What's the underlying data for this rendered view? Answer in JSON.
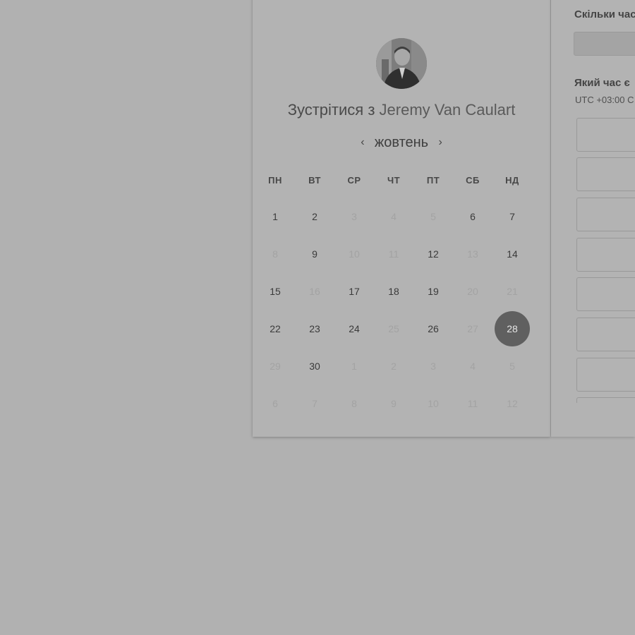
{
  "meeting": {
    "prefix": "Зустрітися з ",
    "host_name": "Jeremy Van Caulart"
  },
  "calendar": {
    "month": "жовтень",
    "prev_icon": "chevron-left-icon",
    "next_icon": "chevron-right-icon",
    "weekdays": [
      "ПН",
      "ВТ",
      "СР",
      "ЧТ",
      "ПТ",
      "СБ",
      "НД"
    ],
    "weeks": [
      [
        {
          "d": "1",
          "off": false
        },
        {
          "d": "2",
          "off": false
        },
        {
          "d": "3",
          "off": true
        },
        {
          "d": "4",
          "off": true
        },
        {
          "d": "5",
          "off": true
        },
        {
          "d": "6",
          "off": false
        },
        {
          "d": "7",
          "off": false
        }
      ],
      [
        {
          "d": "8",
          "off": true
        },
        {
          "d": "9",
          "off": false
        },
        {
          "d": "10",
          "off": true
        },
        {
          "d": "11",
          "off": true
        },
        {
          "d": "12",
          "off": false
        },
        {
          "d": "13",
          "off": true
        },
        {
          "d": "14",
          "off": false
        }
      ],
      [
        {
          "d": "15",
          "off": false
        },
        {
          "d": "16",
          "off": true
        },
        {
          "d": "17",
          "off": false
        },
        {
          "d": "18",
          "off": false
        },
        {
          "d": "19",
          "off": false
        },
        {
          "d": "20",
          "off": true
        },
        {
          "d": "21",
          "off": true
        }
      ],
      [
        {
          "d": "22",
          "off": false
        },
        {
          "d": "23",
          "off": false
        },
        {
          "d": "24",
          "off": false
        },
        {
          "d": "25",
          "off": true
        },
        {
          "d": "26",
          "off": false
        },
        {
          "d": "27",
          "off": true
        },
        {
          "d": "28",
          "off": false,
          "selected": true
        }
      ],
      [
        {
          "d": "29",
          "off": true
        },
        {
          "d": "30",
          "off": false
        },
        {
          "d": "1",
          "off": true
        },
        {
          "d": "2",
          "off": true
        },
        {
          "d": "3",
          "off": true
        },
        {
          "d": "4",
          "off": true
        },
        {
          "d": "5",
          "off": true
        }
      ],
      [
        {
          "d": "6",
          "off": true
        },
        {
          "d": "7",
          "off": true
        },
        {
          "d": "8",
          "off": true
        },
        {
          "d": "9",
          "off": true
        },
        {
          "d": "10",
          "off": true
        },
        {
          "d": "11",
          "off": true
        },
        {
          "d": "12",
          "off": true
        }
      ]
    ],
    "selected_color": "#606060"
  },
  "side_panel": {
    "duration_question": "Скільки час",
    "time_question": "Який час є",
    "timezone": "UTC +03:00 C"
  }
}
